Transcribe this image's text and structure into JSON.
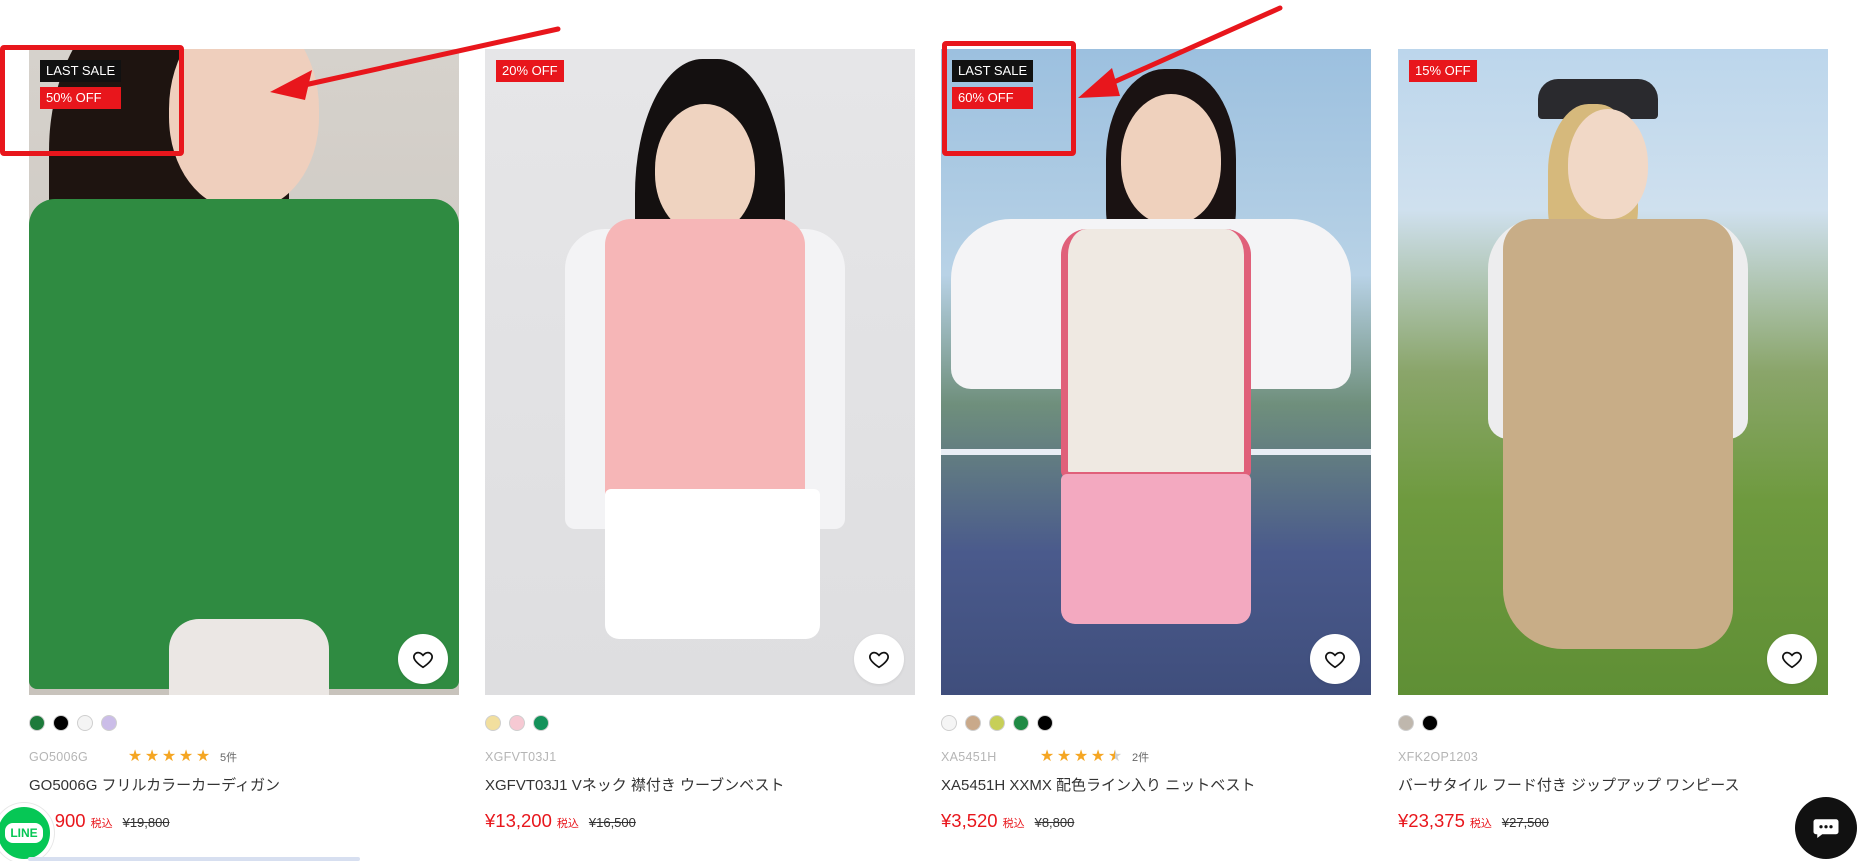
{
  "products": [
    {
      "badges": [
        "LAST SALE",
        "50% OFF"
      ],
      "swatches": [
        "#1d7a3b",
        "#000000",
        "#f4f4f4",
        "#cbbde8"
      ],
      "sku": "GO5006G",
      "rating": 5,
      "reviews": "5件",
      "name": "GO5006G フリルカラーカーディガン",
      "price": "¥9,900",
      "tax": "税込",
      "old_price": "¥19,800",
      "photo_colors": {
        "hair": "#1e1410",
        "garment": "#2f8b41",
        "skin": "#efcfbd"
      }
    },
    {
      "badges": [
        "20% OFF"
      ],
      "swatches": [
        "#f2df9e",
        "#f6c9d3",
        "#13925a"
      ],
      "sku": "XGFVT03J1",
      "rating": null,
      "reviews": "",
      "name": "XGFVT03J1 Vネック 襟付き ウーブンベスト",
      "price": "¥13,200",
      "tax": "税込",
      "old_price": "¥16,500",
      "photo_colors": {
        "hair": "#141010",
        "garment": "#f6b6b7",
        "skin": "#efd3c0"
      }
    },
    {
      "badges": [
        "LAST SALE",
        "60% OFF"
      ],
      "swatches": [
        "#f5f5f5",
        "#c9a98a",
        "#c7cf58",
        "#1f8a44",
        "#000000"
      ],
      "sku": "XA5451H",
      "rating": 4.5,
      "reviews": "2件",
      "name": "XA5451H XXMX 配色ライン入り ニットベスト",
      "price": "¥3,520",
      "tax": "税込",
      "old_price": "¥8,800",
      "photo_colors": {
        "hair": "#1a1212",
        "garment": "#efe9e2",
        "skin": "#efd1bd"
      }
    },
    {
      "badges": [
        "15% OFF"
      ],
      "swatches": [
        "#bfb7ad",
        "#000000"
      ],
      "sku": "XFK2OP1203",
      "rating": null,
      "reviews": "",
      "name": "バーサタイル フード付き ジップアップ ワンピース",
      "price": "¥23,375",
      "tax": "税込",
      "old_price": "¥27,500",
      "photo_colors": {
        "hair": "#d6b97c",
        "garment": "#c8ad87",
        "skin": "#f1d8c6"
      }
    }
  ],
  "widgets": {
    "line_label": "LINE"
  },
  "colors": {
    "accent": "#e8161c",
    "annotation": "#e8161c"
  },
  "icons": {
    "favorite": "heart-icon",
    "chat": "chat-bubble-icon",
    "star": "star-icon"
  }
}
